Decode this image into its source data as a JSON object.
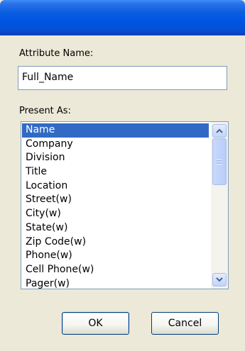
{
  "dialog": {
    "attribute_name_label": "Attribute Name:",
    "attribute_name_value": "Full_Name",
    "present_as_label": "Present As:",
    "present_as_options": [
      "Name",
      "Company",
      "Division",
      "Title",
      "Location",
      "Street(w)",
      "City(w)",
      "State(w)",
      "Zip Code(w)",
      "Phone(w)",
      "Cell Phone(w)",
      "Pager(w)"
    ],
    "selected_option": "Name",
    "ok_label": "OK",
    "cancel_label": "Cancel"
  },
  "icons": {
    "scroll_up": "chevron-up-icon",
    "scroll_down": "chevron-down-icon"
  },
  "colors": {
    "title_bar": "#0054e3",
    "selection": "#316ac5",
    "dialog_background": "#ece9d8"
  }
}
